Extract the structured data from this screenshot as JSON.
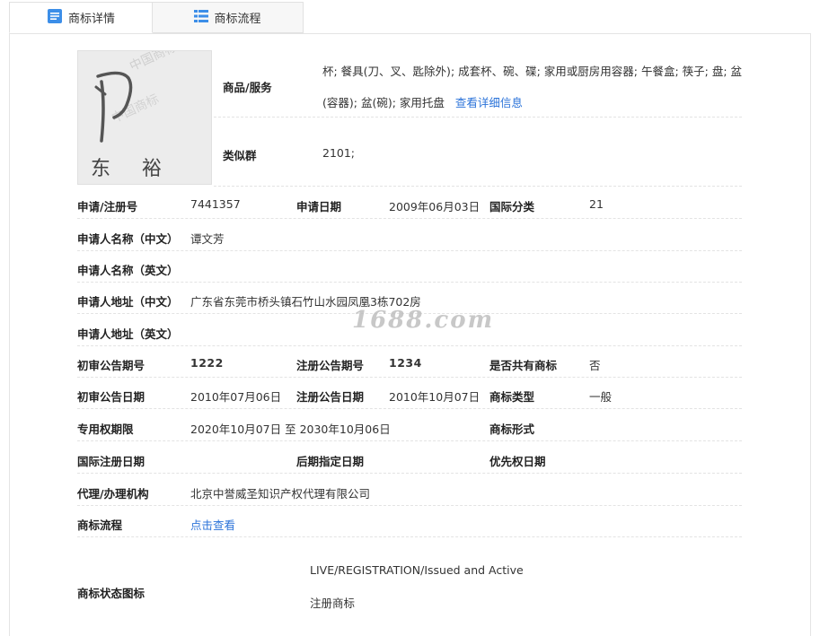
{
  "tabs": [
    {
      "label": "商标详情",
      "icon": "document-icon",
      "active": true
    },
    {
      "label": "商标流程",
      "icon": "list-icon",
      "active": false
    }
  ],
  "logo": {
    "text": "东 裕",
    "watermark": "中国商标"
  },
  "goods": {
    "label": "商品/服务",
    "line1": "杯; 餐具(刀、叉、匙除外); 成套杯、碗、碟; 家用或厨房用容器; 午餐盒; 筷子; 盘; 盆",
    "line2": "(容器); 盆(碗); 家用托盘",
    "link": "查看详细信息"
  },
  "similar_group": {
    "label": "类似群",
    "value": "2101;"
  },
  "fields": {
    "reg_no": {
      "label": "申请/注册号",
      "value": "7441357"
    },
    "app_date": {
      "label": "申请日期",
      "value": "2009年06月03日"
    },
    "intl_class": {
      "label": "国际分类",
      "value": "21"
    },
    "applicant_cn": {
      "label": "申请人名称（中文）",
      "value": "谭文芳"
    },
    "applicant_en": {
      "label": "申请人名称（英文）",
      "value": ""
    },
    "address_cn": {
      "label": "申请人地址（中文）",
      "value": "广东省东莞市桥头镇石竹山水园凤凰3栋702房"
    },
    "address_en": {
      "label": "申请人地址（英文）",
      "value": ""
    },
    "prelim_no": {
      "label": "初审公告期号",
      "value": "1222"
    },
    "reg_notice_no": {
      "label": "注册公告期号",
      "value": "1234"
    },
    "shared": {
      "label": "是否共有商标",
      "value": "否"
    },
    "prelim_date": {
      "label": "初审公告日期",
      "value": "2010年07月06日"
    },
    "reg_notice_date": {
      "label": "注册公告日期",
      "value": "2010年10月07日"
    },
    "tm_type": {
      "label": "商标类型",
      "value": "一般"
    },
    "exclusive_period": {
      "label": "专用权期限",
      "value": "2020年10月07日 至 2030年10月06日"
    },
    "tm_form": {
      "label": "商标形式",
      "value": ""
    },
    "intl_reg_date": {
      "label": "国际注册日期",
      "value": ""
    },
    "later_designation": {
      "label": "后期指定日期",
      "value": ""
    },
    "priority_date": {
      "label": "优先权日期",
      "value": ""
    },
    "agency": {
      "label": "代理/办理机构",
      "value": "北京中誉威圣知识产权代理有限公司"
    },
    "flow": {
      "label": "商标流程",
      "value": "点击查看"
    },
    "status": {
      "label": "商标状态图标",
      "line1": "LIVE/REGISTRATION/Issued and Active",
      "line2": "注册商标"
    }
  },
  "watermark": "1688.com"
}
